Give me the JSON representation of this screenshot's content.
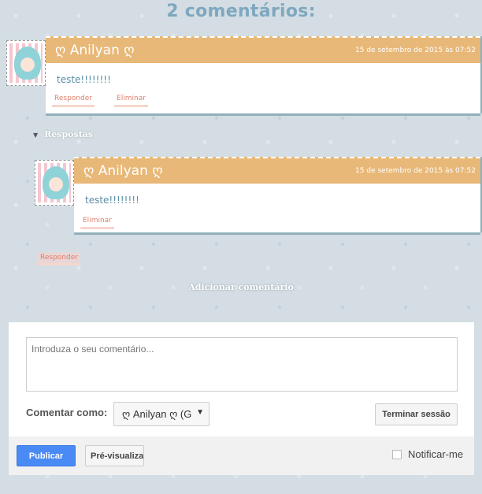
{
  "heading": "2 comentários:",
  "comments": [
    {
      "author": "ღ Anilyan ღ",
      "timestamp": "15 de setembro de 2015 às 07:52",
      "body": "teste!!!!!!!!",
      "actions": [
        "Responder",
        "Eliminar"
      ]
    }
  ],
  "replies_toggle": "Respostas",
  "replies": [
    {
      "author": "ღ Anilyan ღ",
      "timestamp": "15 de setembro de 2015 às 07:52",
      "body": "teste!!!!!!!!",
      "actions": [
        "Eliminar"
      ]
    }
  ],
  "reply_button": "Responder",
  "add_comment": "Adicionar comentário",
  "form": {
    "textarea_placeholder": "Introduza o seu comentário...",
    "comment_as_label": "Comentar como:",
    "identity_value": "ღ Anilyan ღ (G",
    "signout_label": "Terminar sessão",
    "publish_label": "Publicar",
    "preview_label": "Pré-visualizar",
    "notify_label": "Notificar-me",
    "notify_checked": false
  },
  "colors": {
    "accent_header": "#e8b878",
    "link": "#e0806e",
    "heading": "#7fa8bf",
    "publish": "#4a8af4"
  }
}
